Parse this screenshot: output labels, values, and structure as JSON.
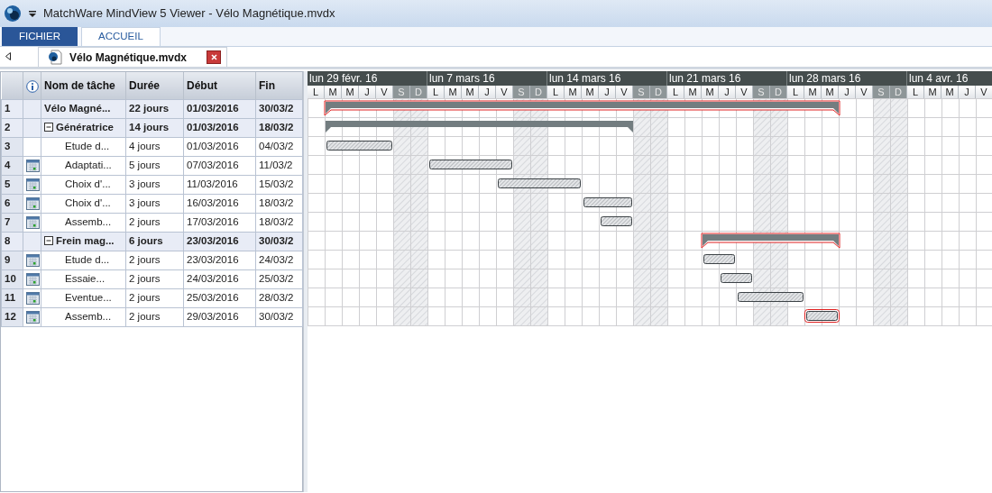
{
  "window": {
    "title": "MatchWare MindView 5 Viewer - Vélo Magnétique.mvdx"
  },
  "ribbon_tabs": [
    {
      "label": "FICHIER",
      "kind": "file",
      "selected": false
    },
    {
      "label": "ACCUEIL",
      "kind": "tab",
      "selected": true
    }
  ],
  "document_tab": {
    "label": "Vélo Magnétique.mvdx"
  },
  "table": {
    "columns": [
      "Nom de tâche",
      "Durée",
      "Début",
      "Fin"
    ],
    "rows": [
      {
        "number": "1",
        "kind": "project",
        "name": "Vélo Magné...",
        "duration": "22 jours",
        "start": "01/03/2016",
        "end": "30/03/2",
        "calendar_icon": false,
        "critical": true,
        "children": [
          {
            "number": "2",
            "kind": "summary",
            "expanded": true,
            "name": "Génératrice",
            "duration": "14 jours",
            "start": "01/03/2016",
            "end": "18/03/2",
            "calendar_icon": false,
            "critical": false,
            "children": [
              {
                "number": "3",
                "kind": "task",
                "name": "Etude d...",
                "duration": "4 jours",
                "start": "01/03/2016",
                "end": "04/03/2",
                "calendar_icon": false,
                "critical": false
              },
              {
                "number": "4",
                "kind": "task",
                "name": "Adaptati...",
                "duration": "5 jours",
                "start": "07/03/2016",
                "end": "11/03/2",
                "calendar_icon": true,
                "critical": false
              },
              {
                "number": "5",
                "kind": "task",
                "name": "Choix d'...",
                "duration": "3 jours",
                "start": "11/03/2016",
                "end": "15/03/2",
                "calendar_icon": true,
                "critical": false
              },
              {
                "number": "6",
                "kind": "task",
                "name": "Choix d'...",
                "duration": "3 jours",
                "start": "16/03/2016",
                "end": "18/03/2",
                "calendar_icon": true,
                "critical": false
              },
              {
                "number": "7",
                "kind": "task",
                "name": "Assemb...",
                "duration": "2 jours",
                "start": "17/03/2016",
                "end": "18/03/2",
                "calendar_icon": true,
                "critical": false
              }
            ]
          },
          {
            "number": "8",
            "kind": "summary",
            "expanded": true,
            "name": "Frein mag...",
            "duration": "6 jours",
            "start": "23/03/2016",
            "end": "30/03/2",
            "calendar_icon": false,
            "critical": true,
            "children": [
              {
                "number": "9",
                "kind": "task",
                "name": "Etude d...",
                "duration": "2 jours",
                "start": "23/03/2016",
                "end": "24/03/2",
                "calendar_icon": true,
                "critical": false
              },
              {
                "number": "10",
                "kind": "task",
                "name": "Essaie...",
                "duration": "2 jours",
                "start": "24/03/2016",
                "end": "25/03/2",
                "calendar_icon": true,
                "critical": false
              },
              {
                "number": "11",
                "kind": "task",
                "name": "Eventue...",
                "duration": "2 jours",
                "start": "25/03/2016",
                "end": "28/03/2",
                "calendar_icon": true,
                "critical": false
              },
              {
                "number": "12",
                "kind": "task",
                "name": "Assemb...",
                "duration": "2 jours",
                "start": "29/03/2016",
                "end": "30/03/2",
                "calendar_icon": true,
                "critical": true
              }
            ]
          }
        ]
      }
    ]
  },
  "timeline": {
    "weeks": [
      "lun 29 févr. 16",
      "lun 7 mars 16",
      "lun 14 mars 16",
      "lun 21 mars 16",
      "lun 28 mars 16",
      "lun 4 avr. 16"
    ],
    "days": [
      {
        "letter": "L",
        "weekend": false
      },
      {
        "letter": "M",
        "weekend": false
      },
      {
        "letter": "M",
        "weekend": false
      },
      {
        "letter": "J",
        "weekend": false
      },
      {
        "letter": "V",
        "weekend": false
      },
      {
        "letter": "S",
        "weekend": true
      },
      {
        "letter": "D",
        "weekend": true
      },
      {
        "letter": "L",
        "weekend": false
      },
      {
        "letter": "M",
        "weekend": false
      },
      {
        "letter": "M",
        "weekend": false
      },
      {
        "letter": "J",
        "weekend": false
      },
      {
        "letter": "V",
        "weekend": false
      },
      {
        "letter": "S",
        "weekend": true
      },
      {
        "letter": "D",
        "weekend": true
      },
      {
        "letter": "L",
        "weekend": false
      },
      {
        "letter": "M",
        "weekend": false
      },
      {
        "letter": "M",
        "weekend": false
      },
      {
        "letter": "J",
        "weekend": false
      },
      {
        "letter": "V",
        "weekend": false
      },
      {
        "letter": "S",
        "weekend": true
      },
      {
        "letter": "D",
        "weekend": true
      },
      {
        "letter": "L",
        "weekend": false
      },
      {
        "letter": "M",
        "weekend": false
      },
      {
        "letter": "M",
        "weekend": false
      },
      {
        "letter": "J",
        "weekend": false
      },
      {
        "letter": "V",
        "weekend": false
      },
      {
        "letter": "S",
        "weekend": true
      },
      {
        "letter": "D",
        "weekend": true
      },
      {
        "letter": "L",
        "weekend": false
      },
      {
        "letter": "M",
        "weekend": false
      },
      {
        "letter": "M",
        "weekend": false
      },
      {
        "letter": "J",
        "weekend": false
      },
      {
        "letter": "V",
        "weekend": false
      },
      {
        "letter": "S",
        "weekend": true
      },
      {
        "letter": "D",
        "weekend": true
      },
      {
        "letter": "L",
        "weekend": false
      },
      {
        "letter": "M",
        "weekend": false
      },
      {
        "letter": "M",
        "weekend": false
      },
      {
        "letter": "J",
        "weekend": false
      },
      {
        "letter": "V",
        "weekend": false
      }
    ]
  }
}
